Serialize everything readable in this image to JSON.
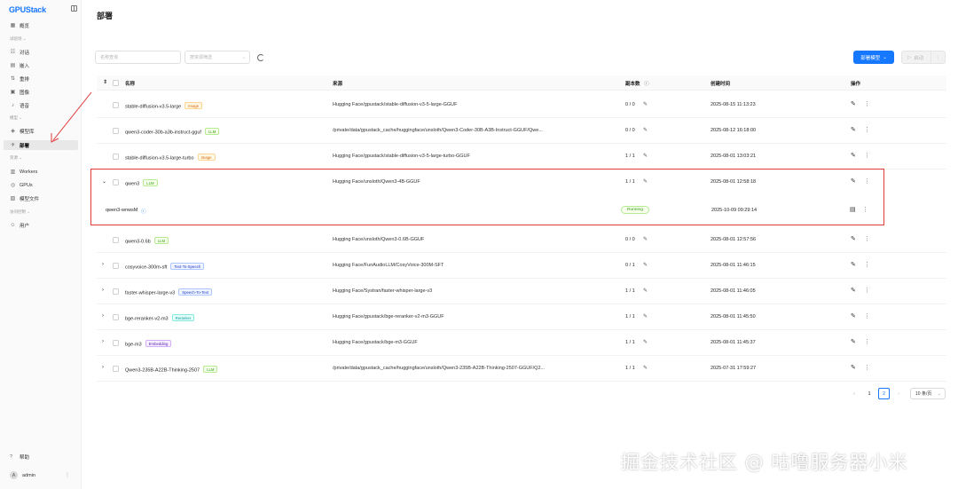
{
  "app": {
    "logo": "GPUStack"
  },
  "sidebar": {
    "items": [
      {
        "label": "概览",
        "icon": "▦"
      },
      {
        "label": "对话",
        "icon": "☷"
      },
      {
        "label": "嵌入",
        "icon": "▤"
      },
      {
        "label": "重排",
        "icon": "⇅"
      },
      {
        "label": "图像",
        "icon": "▣"
      },
      {
        "label": "语音",
        "icon": "♪"
      },
      {
        "label": "模型库",
        "icon": "◈"
      },
      {
        "label": "部署",
        "icon": "✈"
      },
      {
        "label": "Workers",
        "icon": "▥"
      },
      {
        "label": "GPUs",
        "icon": "◎"
      },
      {
        "label": "模型文件",
        "icon": "▧"
      },
      {
        "label": "用户",
        "icon": "☺"
      }
    ],
    "groups": [
      "试验场",
      "模型",
      "资源",
      "访问控制"
    ],
    "help": "帮助",
    "user": {
      "name": "admin",
      "avatar": "A"
    }
  },
  "page": {
    "title": "部署",
    "search_placeholder": "名称查询",
    "filter_placeholder": "按资源筛选",
    "deploy_button": "部署模型",
    "start_button": "启动"
  },
  "table": {
    "columns": [
      "名称",
      "来源",
      "副本数",
      "创建时间",
      "操作"
    ],
    "rows": [
      {
        "name": "stable-diffusion-v3.5-large",
        "tag": "Image",
        "source": "Hugging Face/gpustack/stable-diffusion-v3-5-large-GGUF",
        "replicas": "0 / 0",
        "created": "2025-08-15 11:13:23",
        "expandable": false
      },
      {
        "name": "qwen3-coder-30b-a3b-instruct-gguf",
        "tag": "LLM",
        "source": "/private/data/gpustack_cache/huggingface/unsloth/Qwen3-Coder-30B-A3B-Instruct-GGUF/Qwe...",
        "replicas": "0 / 0",
        "created": "2025-08-12 16:18:00",
        "expandable": false
      },
      {
        "name": "stable-diffusion-v3.5-large-turbo",
        "tag": "Image",
        "source": "Hugging Face/gpustack/stable-diffusion-v3-5-large-turbo-GGUF",
        "replicas": "1 / 1",
        "created": "2025-08-01 13:03:21",
        "expandable": false
      },
      {
        "name": "qwen3",
        "tag": "LLM",
        "source": "Hugging Face/unsloth/Qwen3-4B-GGUF",
        "replicas": "1 / 1",
        "created": "2025-08-01 12:58:18",
        "expandable": true
      },
      {
        "name": "qwen3-0.6b",
        "tag": "LLM",
        "source": "Hugging Face/unsloth/Qwen3-0.6B-GGUF",
        "replicas": "0 / 0",
        "created": "2025-08-01 12:57:56",
        "expandable": false
      },
      {
        "name": "cosyvoice-300m-sft",
        "tag": "Text-To-Speech",
        "source": "Hugging Face/FunAudioLLM/CosyVoice-300M-SFT",
        "replicas": "0 / 1",
        "created": "2025-08-01 11:46:15",
        "expandable": true
      },
      {
        "name": "faster-whisper-large-v3",
        "tag": "Speech-To-Text",
        "source": "Hugging Face/Systran/faster-whisper-large-v3",
        "replicas": "1 / 1",
        "created": "2025-08-01 11:46:05",
        "expandable": true
      },
      {
        "name": "bge-reranker-v2-m3",
        "tag": "Reranker",
        "source": "Hugging Face/gpustack/bge-reranker-v2-m3-GGUF",
        "replicas": "1 / 1",
        "created": "2025-08-01 11:45:50",
        "expandable": true
      },
      {
        "name": "bge-m3",
        "tag": "Embedding",
        "source": "Hugging Face/gpustack/bge-m3-GGUF",
        "replicas": "1 / 1",
        "created": "2025-08-01 11:45:37",
        "expandable": true
      },
      {
        "name": "Qwen3-235B-A22B-Thinking-2507",
        "tag": "LLM",
        "source": "/private/data/gpustack_cache/huggingface/unsloth/Qwen3-235B-A22B-Thinking-2507-GGUF/Q2...",
        "replicas": "1 / 1",
        "created": "2025-07-31 17:59:27",
        "expandable": true
      }
    ],
    "instance": {
      "name": "qwen3-wnwsM",
      "status": "Running",
      "created": "2025-10-09 09:29:14"
    }
  },
  "pagination": {
    "pages": [
      "1",
      "2"
    ],
    "current": "2",
    "page_size": "10 条/页",
    "prev": "‹",
    "next": "›"
  },
  "watermark": "掘金技术社区 @ 咕噜服务器小米"
}
